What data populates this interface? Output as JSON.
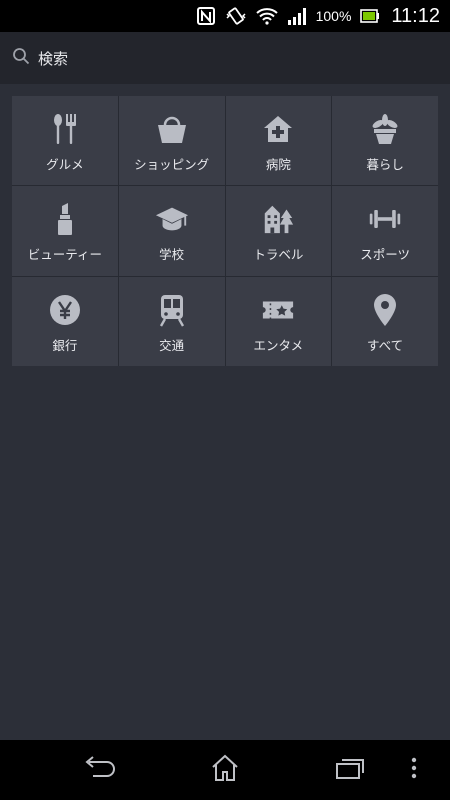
{
  "status_bar": {
    "battery_text": "100%",
    "time": "11:12",
    "icons": [
      "nfc-icon",
      "vibrate-icon",
      "wifi-icon",
      "signal-icon",
      "battery-icon"
    ]
  },
  "search": {
    "label": "検索",
    "icon": "search-icon"
  },
  "categories": [
    {
      "label": "グルメ",
      "icon": "fork-spoon-icon"
    },
    {
      "label": "ショッピング",
      "icon": "shopping-bag-icon"
    },
    {
      "label": "病院",
      "icon": "hospital-icon"
    },
    {
      "label": "暮らし",
      "icon": "plant-pot-icon"
    },
    {
      "label": "ビューティー",
      "icon": "lipstick-icon"
    },
    {
      "label": "学校",
      "icon": "graduation-cap-icon"
    },
    {
      "label": "トラベル",
      "icon": "travel-building-icon"
    },
    {
      "label": "スポーツ",
      "icon": "dumbbell-icon"
    },
    {
      "label": "銀行",
      "icon": "yen-icon"
    },
    {
      "label": "交通",
      "icon": "train-icon"
    },
    {
      "label": "エンタメ",
      "icon": "ticket-icon"
    },
    {
      "label": "すべて",
      "icon": "map-pin-icon"
    }
  ],
  "nav_bar": {
    "buttons": [
      "back-icon",
      "home-icon",
      "recent-apps-icon",
      "menu-icon"
    ]
  },
  "colors": {
    "background": "#2c2f38",
    "tile": "#3a3d47",
    "search_bar": "#23252c",
    "icon": "#b9bcc4"
  }
}
